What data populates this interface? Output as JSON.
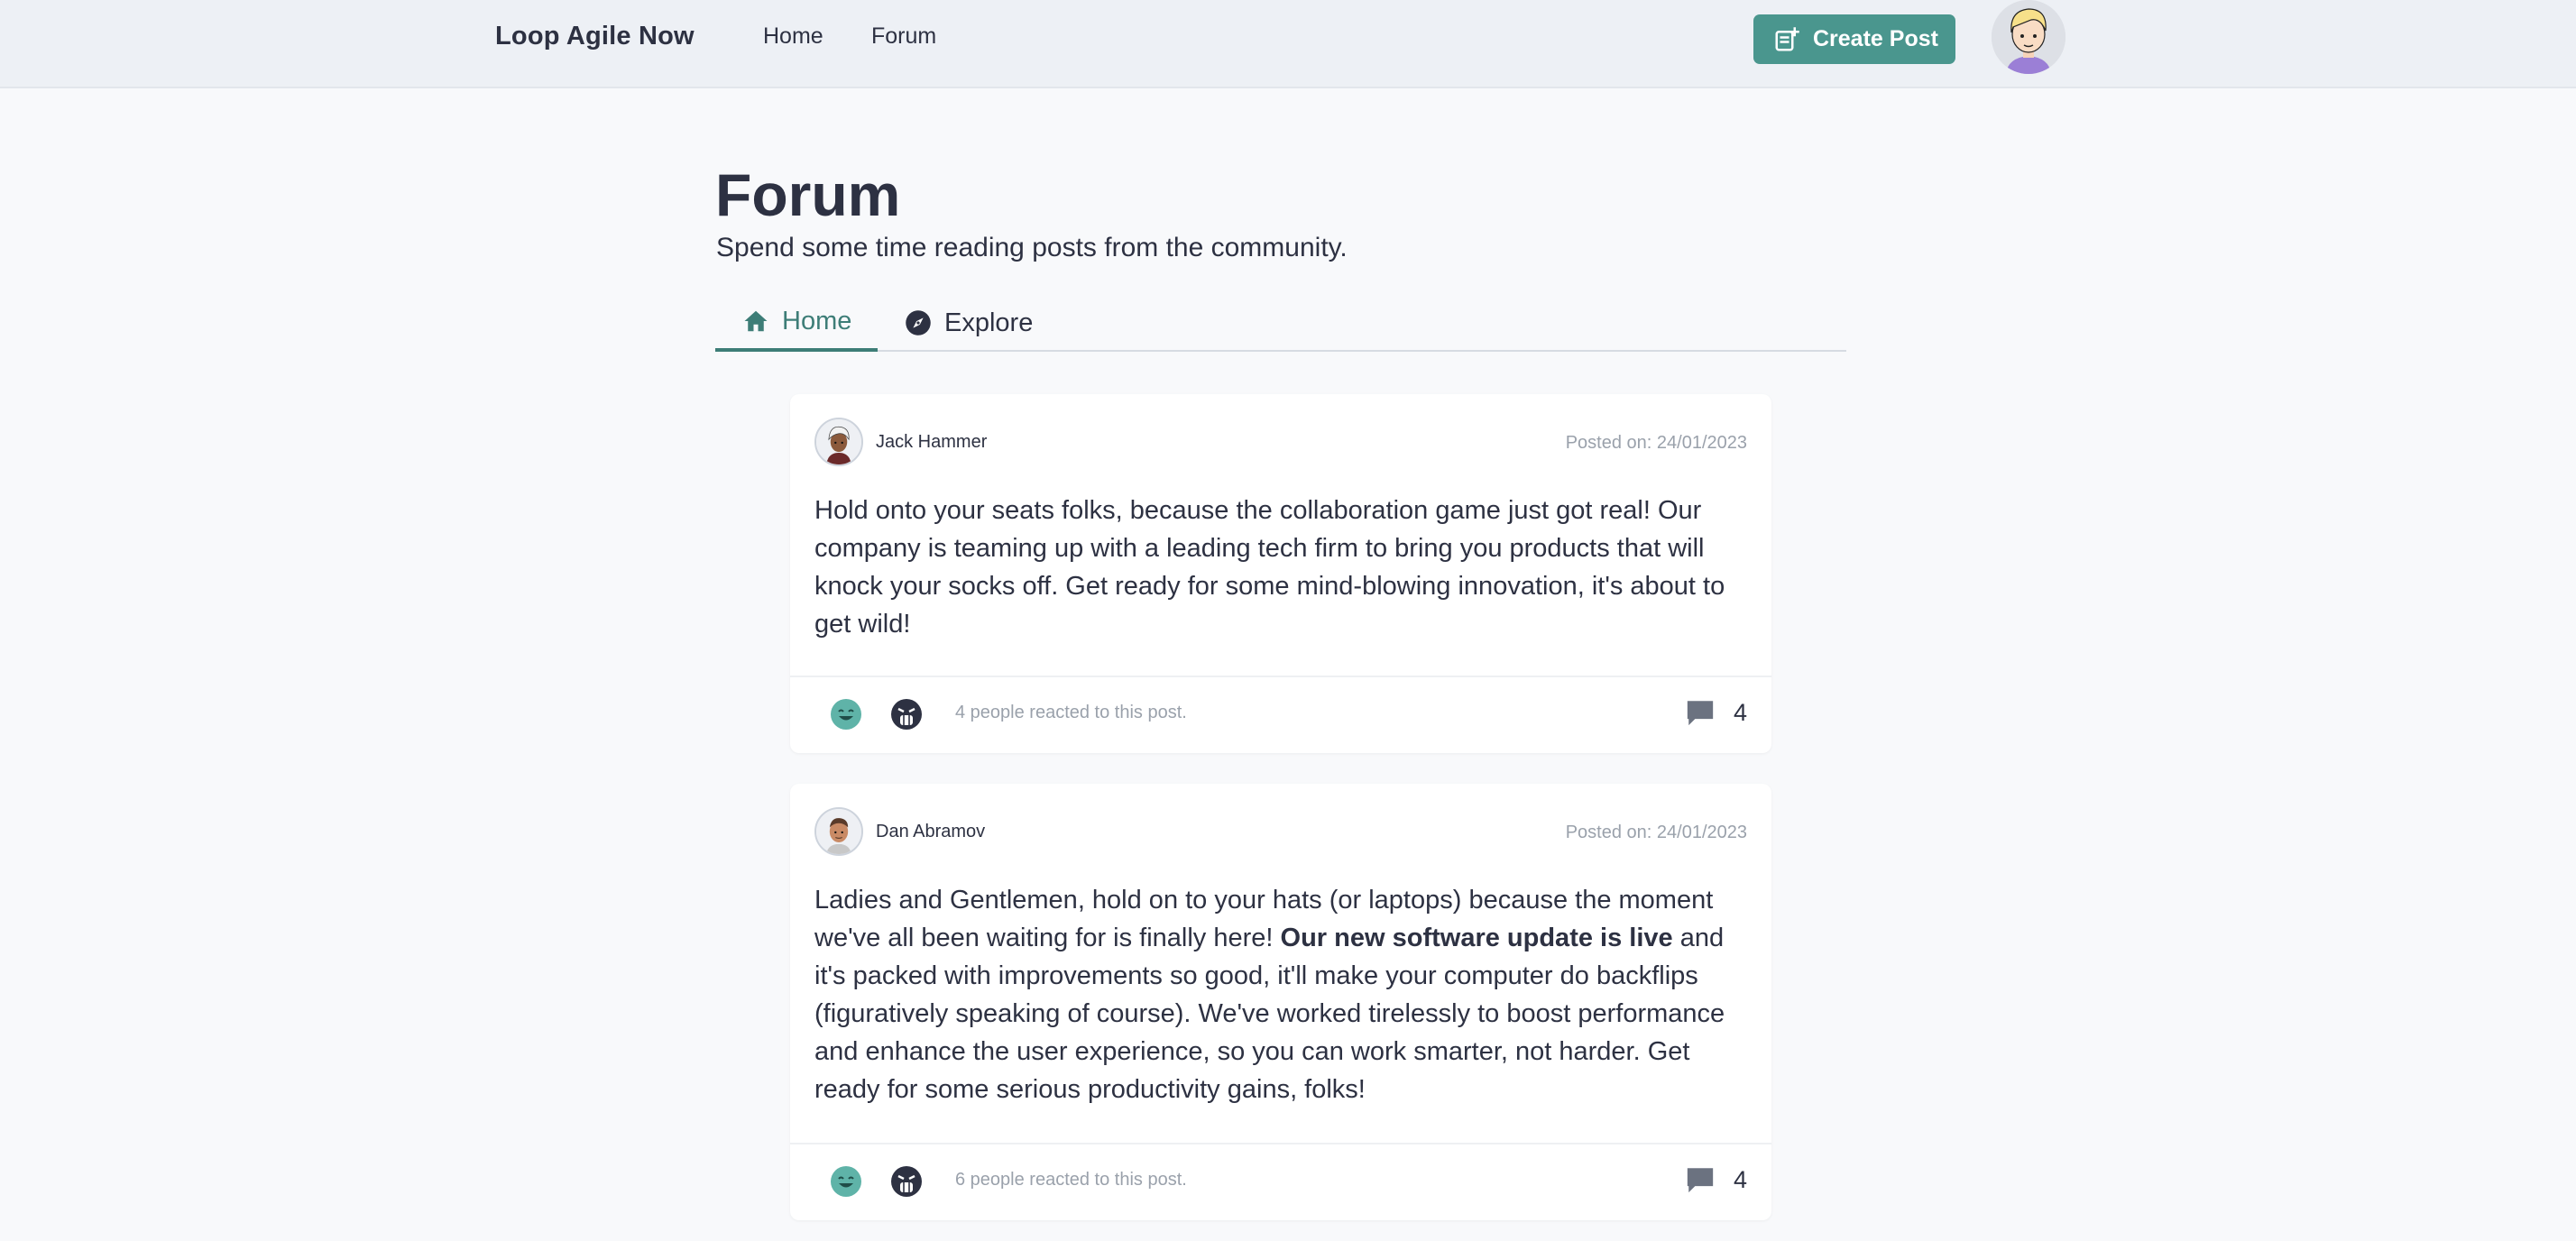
{
  "brand": "Loop Agile Now",
  "nav": {
    "home": "Home",
    "forum": "Forum"
  },
  "create_post_label": "Create Post",
  "page": {
    "title": "Forum",
    "subtitle": "Spend some time reading posts from the community."
  },
  "tabs": {
    "home": "Home",
    "explore": "Explore"
  },
  "colors": {
    "accent": "#4a968e",
    "tab_active": "#3d7d77",
    "text": "#2d3142"
  },
  "posts": [
    {
      "author": "Jack Hammer",
      "date": "Posted on: 24/01/2023",
      "body_plain_1": "Hold onto your seats folks, because the collaboration game just got real! Our company is teaming up with a leading tech firm to bring you products that will knock your socks off. Get ready for some mind-blowing innovation, it's about to get wild!",
      "reactions_text": "4 people reacted to this post.",
      "comments": "4",
      "reaction_icons": [
        "smile-reaction-icon",
        "angry-reaction-icon"
      ]
    },
    {
      "author": "Dan Abramov",
      "date": "Posted on: 24/01/2023",
      "body_plain_1": "Ladies and Gentlemen, hold on to your hats (or laptops) because the moment we've all been waiting for is finally here! ",
      "body_bold": "Our new software update is live",
      "body_plain_2": " and it's packed with improvements so good, it'll make your computer do backflips (figuratively speaking of course). We've worked tirelessly to boost performance and enhance the user experience, so you can work smarter, not harder. Get ready for some serious productivity gains, folks!",
      "reactions_text": "6 people reacted to this post.",
      "comments": "4",
      "reaction_icons": [
        "smile-reaction-icon",
        "angry-reaction-icon"
      ]
    }
  ]
}
